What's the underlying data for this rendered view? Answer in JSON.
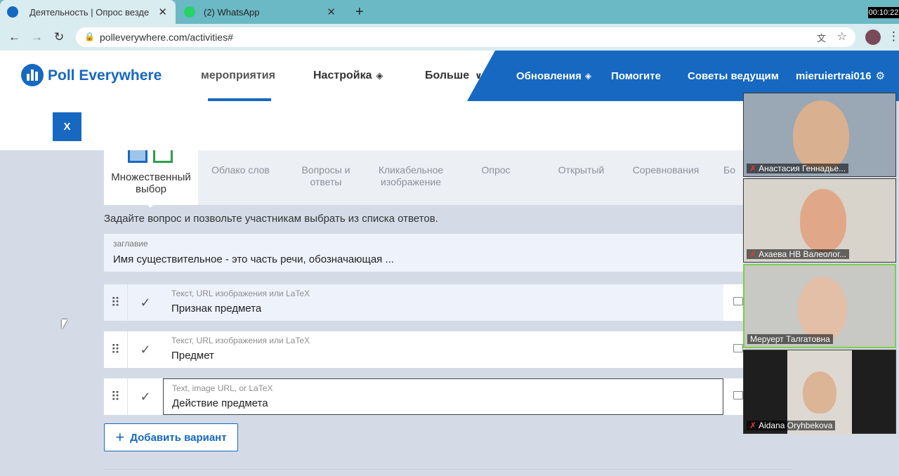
{
  "browser": {
    "tabs": [
      {
        "label": "Деятельность | Опрос везде"
      },
      {
        "label": "(2) WhatsApp"
      }
    ],
    "new_tab_icon": "+",
    "url": "polleverywhere.com/activities#",
    "timer": "00:10:22"
  },
  "header": {
    "logo": "Poll Everywhere",
    "nav": [
      {
        "label": "мероприятия"
      },
      {
        "label": "Настройка"
      },
      {
        "label": "Больше"
      }
    ],
    "right_nav": [
      {
        "label": "Обновления"
      },
      {
        "label": "Помогите"
      },
      {
        "label": "Советы ведущим"
      },
      {
        "label": "mieruiertrai016"
      }
    ],
    "close_label": "X"
  },
  "activity_types": [
    {
      "label": "Множественный выбор"
    },
    {
      "label": "Облако слов"
    },
    {
      "label": "Вопросы и ответы"
    },
    {
      "label": "Кликабельное изображение"
    },
    {
      "label": "Опрос"
    },
    {
      "label": "Открытый"
    },
    {
      "label": "Соревнования"
    },
    {
      "label": "Бо"
    }
  ],
  "form": {
    "description": "Задайте вопрос и позвольте участникам выбрать из списка ответов.",
    "title_label": "заглавие",
    "title_value": "Имя существительное - это часть речи, обозначающая ...",
    "options": [
      {
        "placeholder": "Текст, URL изображения или LaTeX",
        "value": "Признак предмета"
      },
      {
        "placeholder": "Текст, URL изображения или LaTeX",
        "value": "Предмет"
      },
      {
        "placeholder": "Text, image URL, or LaTeX",
        "value": "Действие предмета"
      }
    ],
    "add_option": "Добавить вариант"
  },
  "participants": [
    {
      "name": "Анастасия Геннадье..."
    },
    {
      "name": "Ахаева НВ Валеолог..."
    },
    {
      "name": "Меруерт Талгатовна"
    },
    {
      "name": "Aidana Oryhbekova"
    }
  ],
  "colors": {
    "brand": "#1668c0",
    "tab_bg": "#6bb9c4"
  }
}
